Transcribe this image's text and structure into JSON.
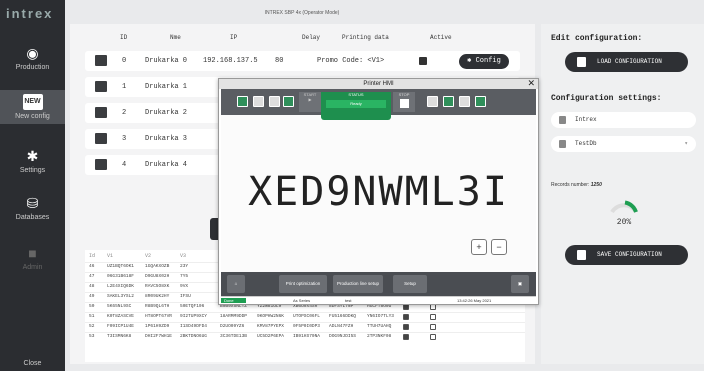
{
  "app": {
    "logo": "intrex",
    "title": "INTREX SBP 4x (Operator Mode)"
  },
  "sidebar": {
    "items": [
      {
        "label": "Production",
        "icon": "target-icon"
      },
      {
        "label": "New config",
        "icon": "new-badge-icon",
        "badge": "NEW"
      },
      {
        "label": "Settings",
        "icon": "gear-icon"
      },
      {
        "label": "Databases",
        "icon": "database-icon"
      },
      {
        "label": "Admin",
        "icon": "lock-icon"
      }
    ],
    "close": "Close"
  },
  "table": {
    "headers": [
      "ID",
      "Nme",
      "IP",
      "Delay",
      "Printing data",
      "Active"
    ],
    "rows": [
      {
        "id": "0",
        "name": "Drukarka 0",
        "ip": "192.168.137.5",
        "delay": "80",
        "data": "Promo Code: <V1>",
        "active": true,
        "config": "Config"
      },
      {
        "id": "1",
        "name": "Drukarka 1"
      },
      {
        "id": "2",
        "name": "Drukarka 2"
      },
      {
        "id": "3",
        "name": "Drukarka 3"
      },
      {
        "id": "4",
        "name": "Drukarka 4"
      }
    ],
    "add": "+"
  },
  "db": {
    "headers": [
      "Id",
      "V1",
      "V2",
      "V3"
    ],
    "rows": [
      {
        "id": "46",
        "v1": "UZ1BQT6OK1",
        "v2": "1GQAKXOZB",
        "v3": "23Y"
      },
      {
        "id": "47",
        "v1": "06G31B618F",
        "v2": "D9GU8X02H",
        "v3": "7Y5"
      },
      {
        "id": "48",
        "v1": "L2E4XIQ6DK",
        "v2": "RAVC5O8XK",
        "v3": "9VX"
      },
      {
        "id": "49",
        "v1": "SAKEL3YSL2",
        "v2": "8R09UK2HY",
        "v3": "IFSU"
      },
      {
        "id": "50",
        "v1": "5K65NL9SC",
        "v2": "R8B9QL6TH",
        "v3": "50ETQF106",
        "v4": "B9B9X5NLTZ",
        "v5": "YZ2W81UL9",
        "v6": "XB6U9X4SR",
        "v7": "8DFSYL7NP",
        "v8": "HGCFT8O0U"
      },
      {
        "id": "51",
        "v1": "K0T8ZASCVE",
        "v2": "HT8OPT67VR",
        "v3": "9I2TUP9XCY",
        "v4": "18ARMM9DDP",
        "v5": "9KOPHW2N6K",
        "v6": "UTOPSC06FL",
        "v7": "FU5166DDKQ",
        "v8": "YN6IO7TLY3"
      },
      {
        "id": "52",
        "v1": "F09ICP1U4E",
        "v2": "1P61H9ZD9",
        "v3": "I1SD49DFD4",
        "v4": "D2UO09YZ6",
        "v5": "KMV87PYEPX",
        "v6": "0F5P0I0DP3",
        "v7": "ADLN47FZH",
        "v8": "TTUH7UAHQ"
      },
      {
        "id": "53",
        "v1": "T3ISMN6K8",
        "v2": "DHI2F7WH1E",
        "v3": "2BKTDNO6UG",
        "v4": "3C36TDE13B",
        "v5": "UC5D2P6EPA",
        "v6": "IB91HS70NA",
        "v7": "DOG9NJDI5S",
        "v8": "2TP3NKF08"
      }
    ]
  },
  "right": {
    "edit_title": "Edit configuration:",
    "load": "LOAD CONFIGURATION",
    "settings_title": "Configuration settings:",
    "name": "Intrex",
    "db": "TestDb",
    "records_label": "Records number:",
    "records": "1250",
    "percent": "20%",
    "progress": 0.2,
    "save": "SAVE CONFIGURATION"
  },
  "hmi": {
    "title": "Printer HMI",
    "start": "START",
    "status": "STATUS",
    "status_val": "Ready",
    "stop": "STOP",
    "text": "XED9NWML3I",
    "print_opt": "Print optimization",
    "prod_line": "Production line setup",
    "setup": "Setup",
    "status_bar": {
      "state": "Done",
      "series": "As Series",
      "job": "test",
      "time": "13:42:26 May 2021"
    }
  }
}
